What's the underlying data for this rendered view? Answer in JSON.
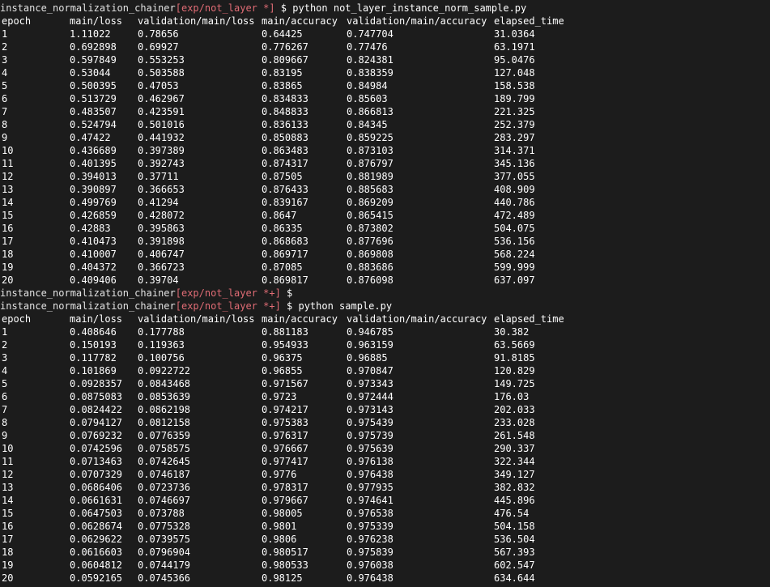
{
  "prompt_path": "instance_normalization_chainer",
  "columns": [
    "epoch",
    "main/loss",
    "validation/main/loss",
    "main/accuracy",
    "validation/main/accuracy",
    "elapsed_time"
  ],
  "prompts": [
    {
      "branch": "[exp/not_layer *]",
      "dollar": "$",
      "command": "python not_layer_instance_norm_sample.py"
    },
    {
      "branch": "[exp/not_layer *+]",
      "dollar": "$",
      "command": ""
    },
    {
      "branch": "[exp/not_layer *+]",
      "dollar": "$",
      "command": "python sample.py"
    }
  ],
  "run1_rows": [
    [
      "1",
      "1.11022",
      "0.78656",
      "0.64425",
      "0.747704",
      "31.0364"
    ],
    [
      "2",
      "0.692898",
      "0.69927",
      "0.776267",
      "0.77476",
      "63.1971"
    ],
    [
      "3",
      "0.597849",
      "0.553253",
      "0.809667",
      "0.824381",
      "95.0476"
    ],
    [
      "4",
      "0.53044",
      "0.503588",
      "0.83195",
      "0.838359",
      "127.048"
    ],
    [
      "5",
      "0.500395",
      "0.47053",
      "0.83865",
      "0.84984",
      "158.538"
    ],
    [
      "6",
      "0.513729",
      "0.462967",
      "0.834833",
      "0.85603",
      "189.799"
    ],
    [
      "7",
      "0.483507",
      "0.423591",
      "0.848833",
      "0.866813",
      "221.325"
    ],
    [
      "8",
      "0.524794",
      "0.501016",
      "0.836133",
      "0.84345",
      "252.379"
    ],
    [
      "9",
      "0.47422",
      "0.441932",
      "0.850883",
      "0.859225",
      "283.297"
    ],
    [
      "10",
      "0.436689",
      "0.397389",
      "0.863483",
      "0.873103",
      "314.371"
    ],
    [
      "11",
      "0.401395",
      "0.392743",
      "0.874317",
      "0.876797",
      "345.136"
    ],
    [
      "12",
      "0.394013",
      "0.37711",
      "0.87505",
      "0.881989",
      "377.055"
    ],
    [
      "13",
      "0.390897",
      "0.366653",
      "0.876433",
      "0.885683",
      "408.909"
    ],
    [
      "14",
      "0.499769",
      "0.41294",
      "0.839167",
      "0.869209",
      "440.786"
    ],
    [
      "15",
      "0.426859",
      "0.428072",
      "0.8647",
      "0.865415",
      "472.489"
    ],
    [
      "16",
      "0.42883",
      "0.395863",
      "0.86335",
      "0.873802",
      "504.075"
    ],
    [
      "17",
      "0.410473",
      "0.391898",
      "0.868683",
      "0.877696",
      "536.156"
    ],
    [
      "18",
      "0.410007",
      "0.406747",
      "0.869717",
      "0.869808",
      "568.224"
    ],
    [
      "19",
      "0.404372",
      "0.366723",
      "0.87085",
      "0.883686",
      "599.999"
    ],
    [
      "20",
      "0.409406",
      "0.39704",
      "0.869817",
      "0.876098",
      "637.097"
    ]
  ],
  "run2_rows": [
    [
      "1",
      "0.408646",
      "0.177788",
      "0.881183",
      "0.946785",
      "30.382"
    ],
    [
      "2",
      "0.150193",
      "0.119363",
      "0.954933",
      "0.963159",
      "63.5669"
    ],
    [
      "3",
      "0.117782",
      "0.100756",
      "0.96375",
      "0.96885",
      "91.8185"
    ],
    [
      "4",
      "0.101869",
      "0.0922722",
      "0.96855",
      "0.970847",
      "120.829"
    ],
    [
      "5",
      "0.0928357",
      "0.0843468",
      "0.971567",
      "0.973343",
      "149.725"
    ],
    [
      "6",
      "0.0875083",
      "0.0853639",
      "0.9723",
      "0.972444",
      "176.03"
    ],
    [
      "7",
      "0.0824422",
      "0.0862198",
      "0.974217",
      "0.973143",
      "202.033"
    ],
    [
      "8",
      "0.0794127",
      "0.0812158",
      "0.975383",
      "0.975439",
      "233.028"
    ],
    [
      "9",
      "0.0769232",
      "0.0776359",
      "0.976317",
      "0.975739",
      "261.548"
    ],
    [
      "10",
      "0.0742596",
      "0.0758575",
      "0.976667",
      "0.975639",
      "290.337"
    ],
    [
      "11",
      "0.0713463",
      "0.0742645",
      "0.977417",
      "0.976138",
      "322.344"
    ],
    [
      "12",
      "0.0707329",
      "0.0746187",
      "0.9776",
      "0.976438",
      "349.127"
    ],
    [
      "13",
      "0.0686406",
      "0.0723736",
      "0.978317",
      "0.977935",
      "382.832"
    ],
    [
      "14",
      "0.0661631",
      "0.0746697",
      "0.979667",
      "0.974641",
      "445.896"
    ],
    [
      "15",
      "0.0647503",
      "0.073788",
      "0.98005",
      "0.976538",
      "476.54"
    ],
    [
      "16",
      "0.0628674",
      "0.0775328",
      "0.9801",
      "0.975339",
      "504.158"
    ],
    [
      "17",
      "0.0629622",
      "0.0739575",
      "0.9806",
      "0.976238",
      "536.504"
    ],
    [
      "18",
      "0.0616603",
      "0.0796904",
      "0.980517",
      "0.975839",
      "567.393"
    ],
    [
      "19",
      "0.0604812",
      "0.0744179",
      "0.980533",
      "0.976038",
      "602.547"
    ],
    [
      "20",
      "0.0592165",
      "0.0745366",
      "0.98125",
      "0.976438",
      "634.644"
    ]
  ]
}
